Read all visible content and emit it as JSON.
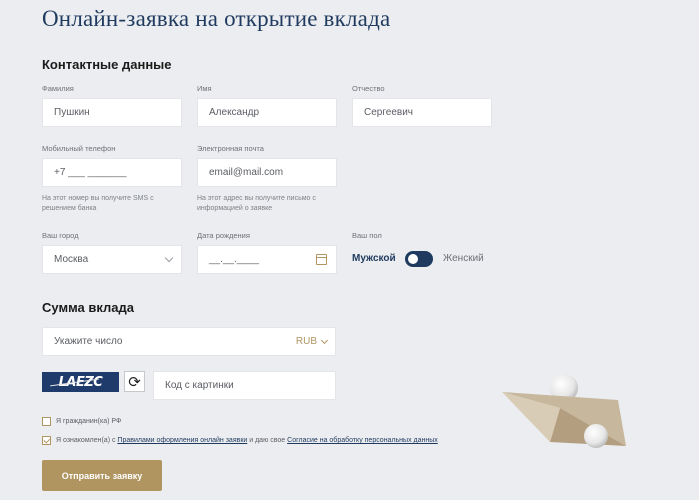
{
  "page": {
    "title": "Онлайн-заявка на открытие вклада"
  },
  "contacts": {
    "heading": "Контактные данные",
    "last_name": {
      "label": "Фамилия",
      "value": "Пушкин"
    },
    "first_name": {
      "label": "Имя",
      "value": "Александр"
    },
    "middle_name": {
      "label": "Отчество",
      "value": "Сергеевич"
    },
    "phone": {
      "label": "Мобильный телефон",
      "value": "+7 ___ _______",
      "hint": "На этот номер вы получите SMS с решением банка"
    },
    "email": {
      "label": "Электронная почта",
      "placeholder": "email@mail.com",
      "hint": "На этот адрес вы получите письмо с информацией о заявке"
    },
    "city": {
      "label": "Ваш город",
      "value": "Москва"
    },
    "birthdate": {
      "label": "Дата рождения",
      "value": "__.__.____"
    },
    "gender": {
      "label": "Ваш пол",
      "male": "Мужской",
      "female": "Женский",
      "selected": "Мужской"
    }
  },
  "deposit": {
    "heading": "Сумма вклада",
    "amount_placeholder": "Укажите число",
    "currency": "RUB"
  },
  "captcha": {
    "image_text": "LAEZC",
    "input_placeholder": "Код с картинки",
    "refresh_icon": "refresh-icon"
  },
  "agreements": {
    "citizen": {
      "label": "Я гражданин(ка) РФ",
      "checked": false
    },
    "consent": {
      "checked": true,
      "prefix": "Я ознакомлен(а) с ",
      "link1": "Правилами оформления онлайн заявки",
      "middle": " и даю свое ",
      "link2": "Согласие на обработку персональных данных"
    }
  },
  "submit_label": "Отправить заявку",
  "colors": {
    "accent": "#b09560",
    "primary": "#1f3a5f",
    "background": "#ebedf0"
  }
}
